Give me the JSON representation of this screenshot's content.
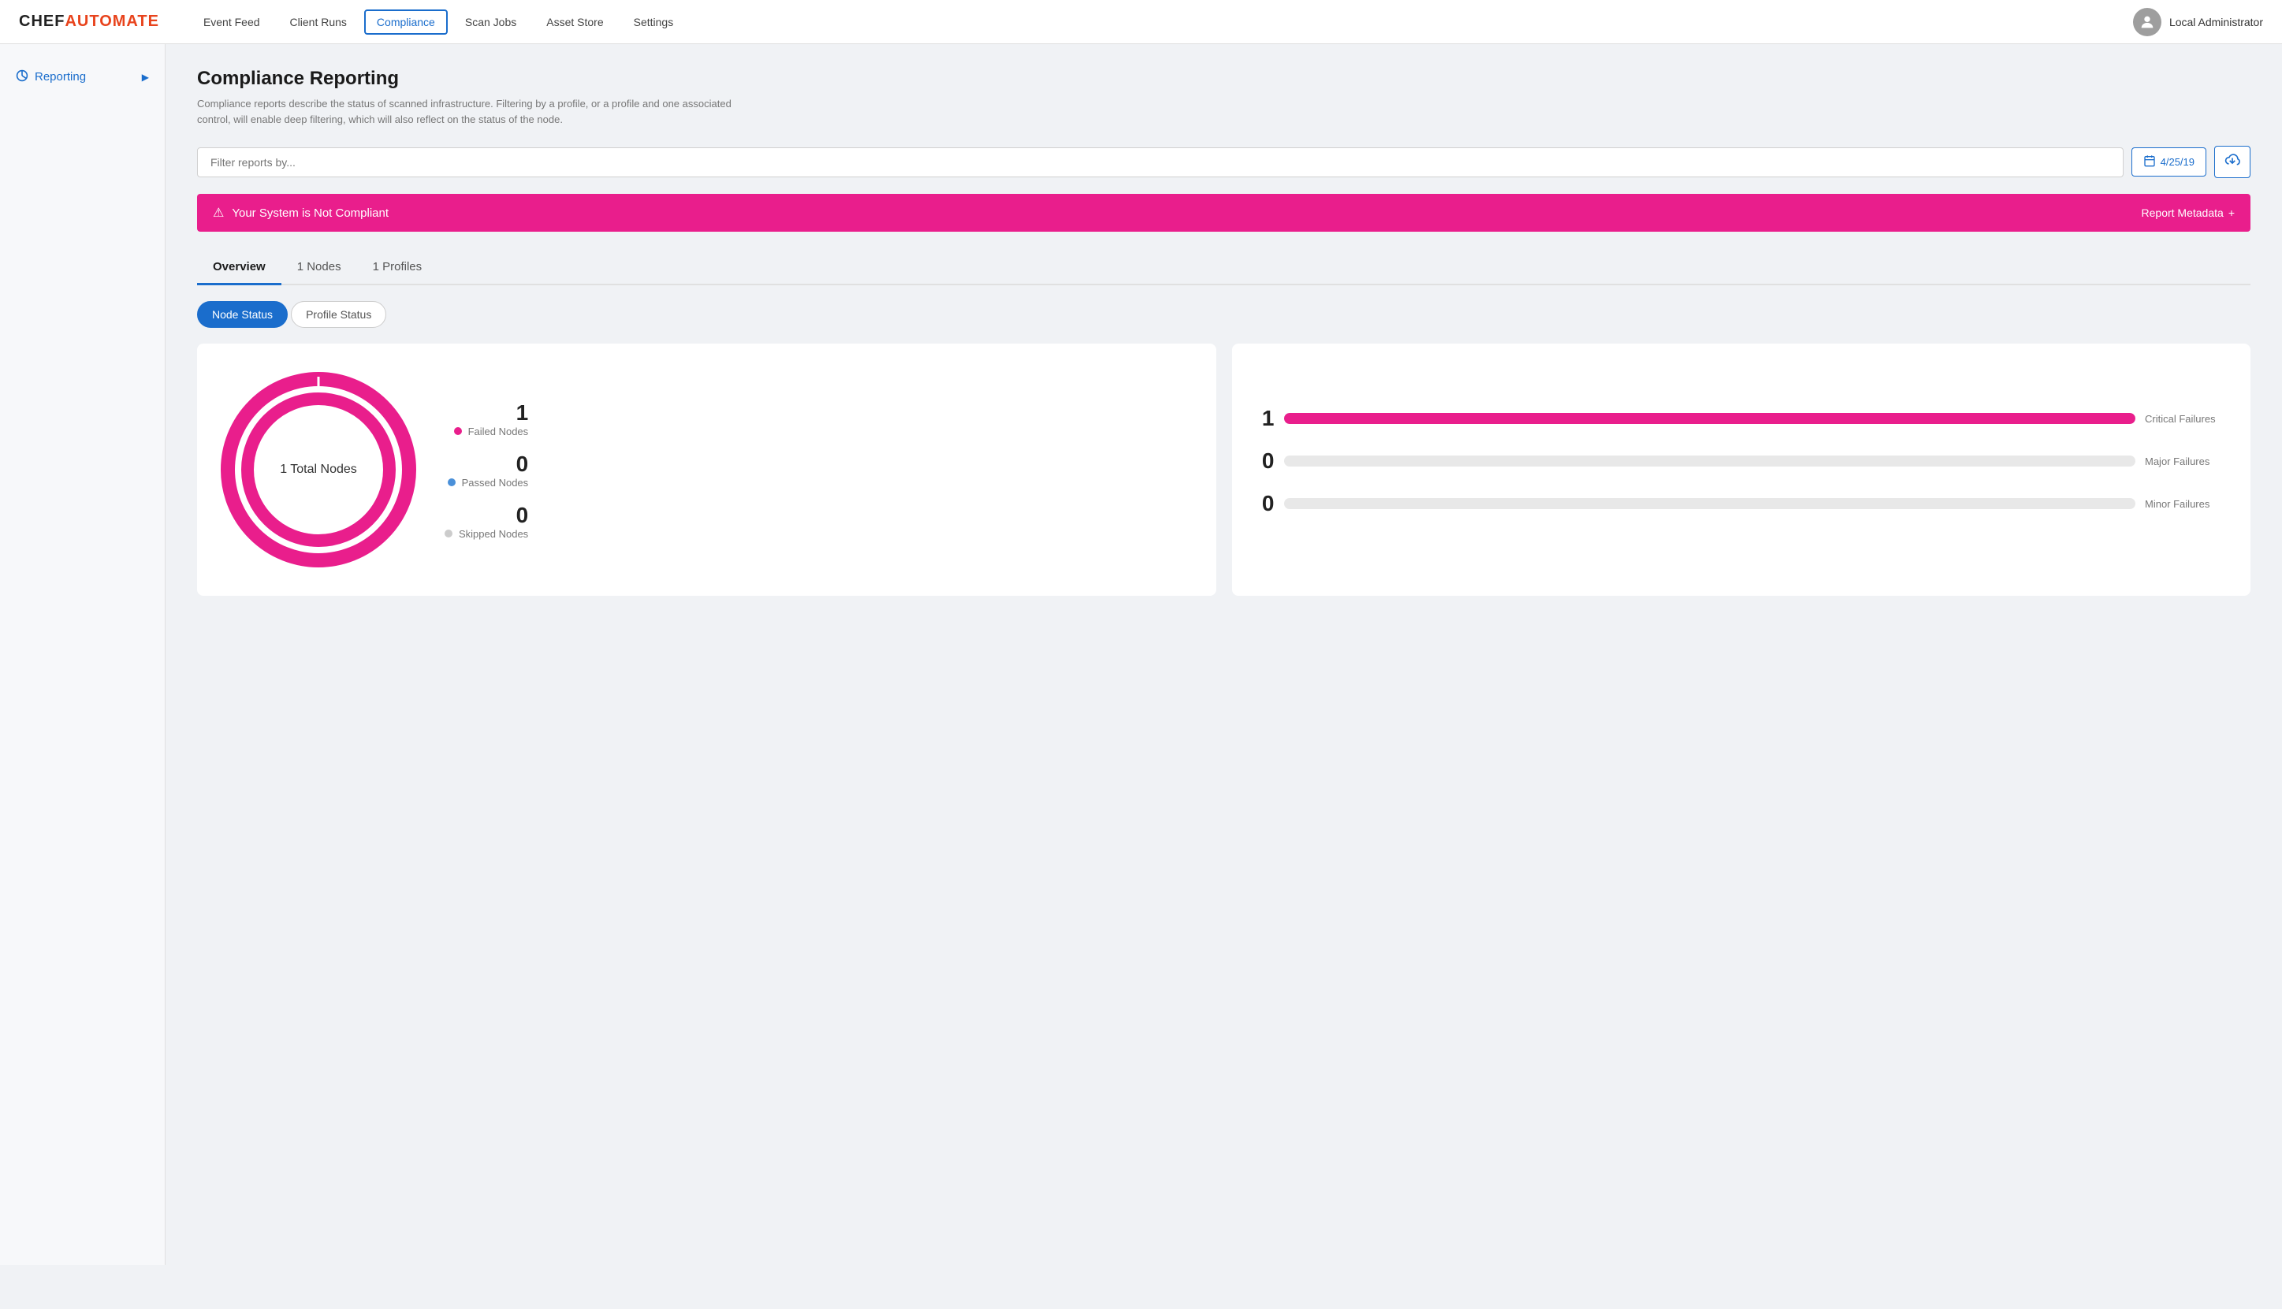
{
  "app": {
    "logo_chef": "CHEF",
    "logo_automate": "AUTOMATE"
  },
  "nav": {
    "links": [
      {
        "label": "Event Feed",
        "active": false
      },
      {
        "label": "Client Runs",
        "active": false
      },
      {
        "label": "Compliance",
        "active": true
      },
      {
        "label": "Scan Jobs",
        "active": false
      },
      {
        "label": "Asset Store",
        "active": false
      },
      {
        "label": "Settings",
        "active": false
      }
    ],
    "user_label": "Local Administrator"
  },
  "sidebar": {
    "item_label": "Reporting",
    "item_icon": "◈",
    "arrow_icon": "▶"
  },
  "page": {
    "title": "Compliance Reporting",
    "description": "Compliance reports describe the status of scanned infrastructure. Filtering by a profile, or a profile and one associated control, will enable deep filtering, which will also reflect on the status of the node."
  },
  "filter": {
    "placeholder": "Filter reports by...",
    "date_label": "4/25/19",
    "calendar_icon": "📅",
    "cloud_icon": "☁"
  },
  "alert": {
    "icon": "⚠",
    "message": "Your System is Not Compliant",
    "metadata_label": "Report Metadata",
    "plus_icon": "+"
  },
  "tabs": [
    {
      "label": "Overview",
      "active": true
    },
    {
      "label": "1 Nodes",
      "active": false
    },
    {
      "label": "1 Profiles",
      "active": false
    }
  ],
  "toggle": {
    "buttons": [
      {
        "label": "Node Status",
        "active": true
      },
      {
        "label": "Profile Status",
        "active": false
      }
    ]
  },
  "donut_chart": {
    "center_label": "1 Total Nodes",
    "legend": [
      {
        "count": "1",
        "label": "Failed Nodes",
        "color": "#e91e8c"
      },
      {
        "count": "0",
        "label": "Passed Nodes",
        "color": "#4a90d9"
      },
      {
        "count": "0",
        "label": "Skipped Nodes",
        "color": "#ccc"
      }
    ]
  },
  "bar_chart": {
    "bars": [
      {
        "count": "1",
        "label": "Critical Failures",
        "fill_color": "#e91e8c",
        "fill_pct": 100
      },
      {
        "count": "0",
        "label": "Major Failures",
        "fill_color": "#e0e0e0",
        "fill_pct": 0
      },
      {
        "count": "0",
        "label": "Minor Failures",
        "fill_color": "#e0e0e0",
        "fill_pct": 0
      }
    ]
  }
}
